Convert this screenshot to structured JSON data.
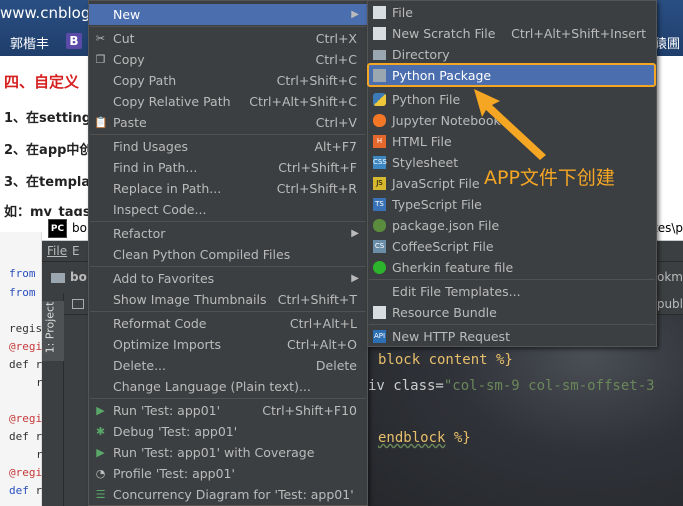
{
  "blog": {
    "url": "www.cnblogs",
    "user": "郭楷丰",
    "b_badge": "B",
    "right_fragment": "猿圃",
    "heading": "四、自定义",
    "line1": "1、在setting",
    "line2": "2、在app中创",
    "line3": "3、在templat",
    "line4": "如：my_tags",
    "code": {
      "l1_kw": "from",
      "l2_kw": "from",
      "l3": "regis",
      "l4_dec": "@regi",
      "l5_kw": "def",
      "l5_rest": "r",
      "l6": "r",
      "l7_dec": "@regi",
      "l8_kw": "def",
      "l8_rest": "r",
      "l9": "r",
      "l10_dec": "@regi",
      "l11_kw": "def",
      "l11_rest": "r"
    }
  },
  "ide": {
    "title_icon": "PC",
    "title_text": "bo",
    "path_text": "tes\\p",
    "menu_file": "File",
    "menu_edit": "E",
    "navbar_text": "bo",
    "navbar_right": "ookm",
    "tab_right": "\\publ",
    "project_label": "1: Project",
    "editor_lines": {
      "l1_tag": "block content %}",
      "l2_pre": "iv class=",
      "l2_str": "\"col-sm-9 col-sm-offset-3",
      "l3_tag": "endblock",
      "l3_end": " %}"
    }
  },
  "context_menu": {
    "items": [
      {
        "label": "New",
        "shortcut": "",
        "submenu": true
      },
      {
        "label": "Cut",
        "shortcut": "Ctrl+X"
      },
      {
        "label": "Copy",
        "shortcut": "Ctrl+C"
      },
      {
        "label": "Copy Path",
        "shortcut": "Ctrl+Shift+C"
      },
      {
        "label": "Copy Relative Path",
        "shortcut": "Ctrl+Alt+Shift+C"
      },
      {
        "label": "Paste",
        "shortcut": "Ctrl+V"
      },
      {
        "label": "Find Usages",
        "shortcut": "Alt+F7"
      },
      {
        "label": "Find in Path...",
        "shortcut": "Ctrl+Shift+F"
      },
      {
        "label": "Replace in Path...",
        "shortcut": "Ctrl+Shift+R"
      },
      {
        "label": "Inspect Code...",
        "shortcut": ""
      },
      {
        "label": "Refactor",
        "shortcut": "",
        "submenu": true
      },
      {
        "label": "Clean Python Compiled Files",
        "shortcut": ""
      },
      {
        "label": "Add to Favorites",
        "shortcut": "",
        "submenu": true
      },
      {
        "label": "Show Image Thumbnails",
        "shortcut": "Ctrl+Shift+T"
      },
      {
        "label": "Reformat Code",
        "shortcut": "Ctrl+Alt+L"
      },
      {
        "label": "Optimize Imports",
        "shortcut": "Ctrl+Alt+O"
      },
      {
        "label": "Delete...",
        "shortcut": "Delete"
      },
      {
        "label": "Change Language (Plain text)...",
        "shortcut": ""
      },
      {
        "label": "Run 'Test: app01'",
        "shortcut": "Ctrl+Shift+F10"
      },
      {
        "label": "Debug 'Test: app01'",
        "shortcut": ""
      },
      {
        "label": "Run 'Test: app01' with Coverage",
        "shortcut": ""
      },
      {
        "label": "Profile 'Test: app01'",
        "shortcut": ""
      },
      {
        "label": "Concurrency Diagram for 'Test: app01'",
        "shortcut": ""
      }
    ]
  },
  "submenu": {
    "items": [
      {
        "label": "File",
        "shortcut": "",
        "icon": "file-icon"
      },
      {
        "label": "New Scratch File",
        "shortcut": "Ctrl+Alt+Shift+Insert",
        "icon": "scratch-file-icon"
      },
      {
        "label": "Directory",
        "shortcut": "",
        "icon": "folder-icon"
      },
      {
        "label": "Python Package",
        "shortcut": "",
        "icon": "python-package-icon"
      },
      {
        "label": "Python File",
        "shortcut": "",
        "icon": "python-file-icon"
      },
      {
        "label": "Jupyter Notebook",
        "shortcut": "",
        "icon": "jupyter-icon"
      },
      {
        "label": "HTML File",
        "shortcut": "",
        "icon": "html-icon"
      },
      {
        "label": "Stylesheet",
        "shortcut": "",
        "icon": "css-icon"
      },
      {
        "label": "JavaScript File",
        "shortcut": "",
        "icon": "js-icon"
      },
      {
        "label": "TypeScript File",
        "shortcut": "",
        "icon": "ts-icon"
      },
      {
        "label": "package.json File",
        "shortcut": "",
        "icon": "npm-icon"
      },
      {
        "label": "CoffeeScript File",
        "shortcut": "",
        "icon": "coffee-icon"
      },
      {
        "label": "Gherkin feature file",
        "shortcut": "",
        "icon": "gherkin-icon"
      },
      {
        "label": "Edit File Templates...",
        "shortcut": "",
        "icon": ""
      },
      {
        "label": "Resource Bundle",
        "shortcut": "",
        "icon": "resource-bundle-icon"
      },
      {
        "label": "New HTTP Request",
        "shortcut": "",
        "icon": "http-request-icon"
      }
    ]
  },
  "annotation": {
    "text": "APP文件下创建",
    "color": "#f5a623"
  },
  "colors": {
    "selection": "#4b6eaf",
    "menu_bg": "#3c3f41",
    "blog_heading": "#d61f1f"
  }
}
